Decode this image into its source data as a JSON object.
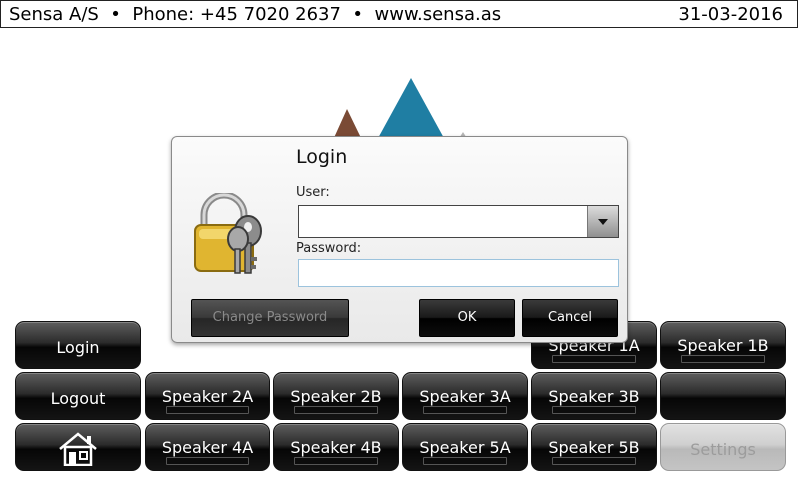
{
  "header": {
    "company": "Sensa A/S",
    "phone": "Phone: +45 7020 2637",
    "website": "www.sensa.as",
    "separator": "•",
    "date": "31-03-2016"
  },
  "buttons": {
    "login": "Login",
    "logout": "Logout",
    "home_icon": "house-icon",
    "speaker_1a": "Speaker 1A",
    "speaker_1b": "Speaker 1B",
    "speaker_2a": "Speaker 2A",
    "speaker_2b": "Speaker 2B",
    "speaker_3a": "Speaker 3A",
    "speaker_3b": "Speaker 3B",
    "speaker_4a": "Speaker 4A",
    "speaker_4b": "Speaker 4B",
    "speaker_5a": "Speaker 5A",
    "speaker_5b": "Speaker 5B",
    "settings": "Settings"
  },
  "dialog": {
    "title": "Login",
    "user_label": "User:",
    "user_value": "",
    "password_label": "Password:",
    "password_value": "",
    "change_password": "Change Password",
    "ok": "OK",
    "cancel": "Cancel",
    "icon": "padlock-keys-icon"
  },
  "colors": {
    "logo_brown": "#7a4a35",
    "logo_teal": "#1f7ea3",
    "button_dark": "#0a0a0a",
    "settings_disabled": "#c6c6c6"
  }
}
